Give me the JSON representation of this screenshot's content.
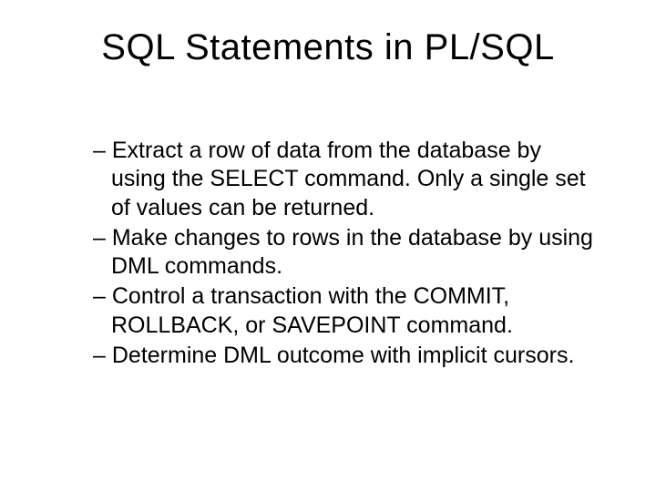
{
  "title": "SQL Statements in PL/SQL",
  "bullets": [
    "Extract a row of data from the database by using the SELECT command. Only a single set of values can be returned.",
    "Make changes to rows in the database by using DML commands.",
    "Control a transaction with the COMMIT, ROLLBACK, or SAVEPOINT command.",
    "Determine DML outcome with implicit cursors."
  ]
}
